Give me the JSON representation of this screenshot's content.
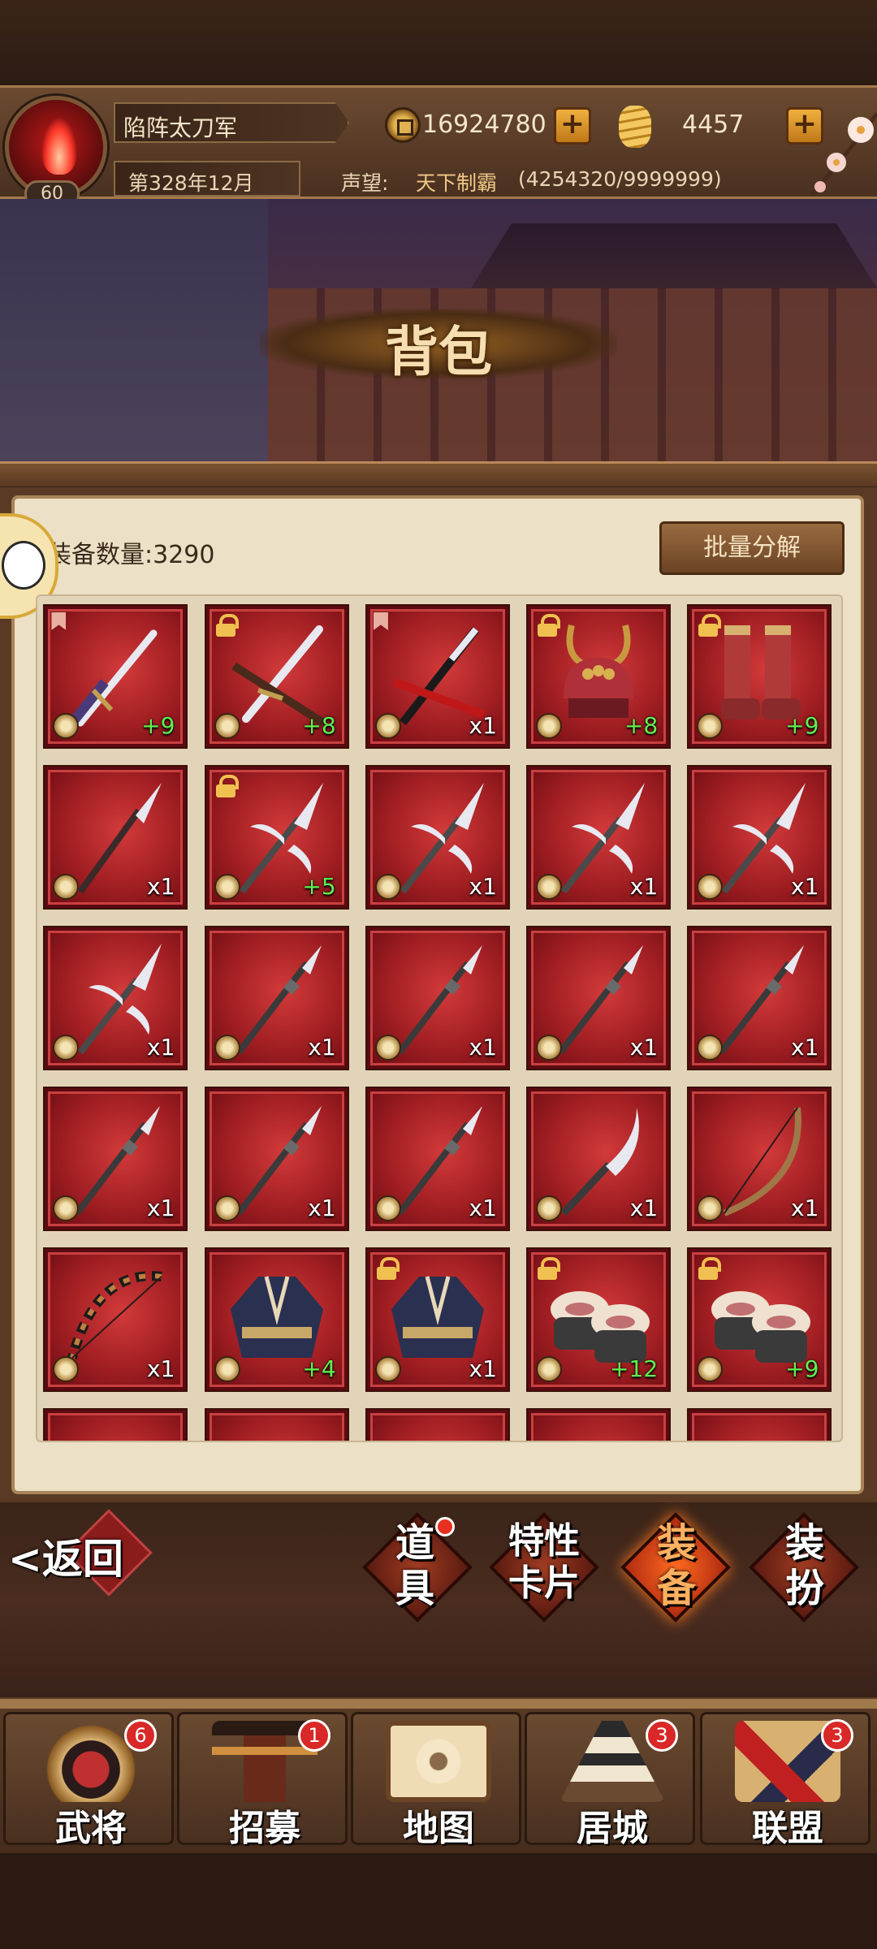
{
  "header": {
    "player_name": "陷阵太刀军",
    "level": "60",
    "game_date": "第328年12月",
    "coins": "16924780",
    "gold": "4457",
    "reputation_label": "声望:",
    "reputation_title": "天下制霸",
    "reputation_progress": "(4254320/9999999)",
    "plus_icon": "+"
  },
  "page": {
    "title": "背包",
    "equip_count_text": "装备数量:3290",
    "batch_button": "批量分解"
  },
  "items": [
    {
      "icon": "katana-icon",
      "qty": "+9",
      "locked": false
    },
    {
      "icon": "katana-pair-icon",
      "qty": "+8",
      "locked": true
    },
    {
      "icon": "katana-red-icon",
      "qty": "x1",
      "locked": false
    },
    {
      "icon": "kabuto-helmet-icon",
      "qty": "+8",
      "locked": true
    },
    {
      "icon": "armored-boots-icon",
      "qty": "+9",
      "locked": true
    },
    {
      "icon": "spear-icon",
      "qty": "x1",
      "locked": false
    },
    {
      "icon": "cross-spear-icon",
      "qty": "+5",
      "locked": true
    },
    {
      "icon": "cross-spear-icon",
      "qty": "x1",
      "locked": false
    },
    {
      "icon": "cross-spear-icon",
      "qty": "x1",
      "locked": false
    },
    {
      "icon": "cross-spear-icon",
      "qty": "x1",
      "locked": false
    },
    {
      "icon": "cross-spear-icon",
      "qty": "x1",
      "locked": false
    },
    {
      "icon": "yari-spear-icon",
      "qty": "x1",
      "locked": false
    },
    {
      "icon": "yari-spear-icon",
      "qty": "x1",
      "locked": false
    },
    {
      "icon": "yari-spear-icon",
      "qty": "x1",
      "locked": false
    },
    {
      "icon": "yari-spear-icon",
      "qty": "x1",
      "locked": false
    },
    {
      "icon": "yari-spear-icon",
      "qty": "x1",
      "locked": false
    },
    {
      "icon": "yari-spear-icon",
      "qty": "x1",
      "locked": false
    },
    {
      "icon": "yari-spear-icon",
      "qty": "x1",
      "locked": false
    },
    {
      "icon": "naginata-icon",
      "qty": "x1",
      "locked": false
    },
    {
      "icon": "longbow-icon",
      "qty": "x1",
      "locked": false
    },
    {
      "icon": "striped-bow-icon",
      "qty": "x1",
      "locked": false
    },
    {
      "icon": "kimono-robe-icon",
      "qty": "+4",
      "locked": false
    },
    {
      "icon": "kimono-robe-icon",
      "qty": "x1",
      "locked": true
    },
    {
      "icon": "sandals-icon",
      "qty": "+12",
      "locked": true
    },
    {
      "icon": "sandals-icon",
      "qty": "+9",
      "locked": true
    }
  ],
  "tabs": [
    {
      "label": "道具",
      "id": "items"
    },
    {
      "label": "特性卡片",
      "id": "trait-cards"
    },
    {
      "label": "装备",
      "id": "equipment"
    },
    {
      "label": "装扮",
      "id": "outfits"
    }
  ],
  "back_label": "<返回",
  "nav": [
    {
      "label": "武将",
      "badge": "6",
      "icon": "samurai-helmet-icon"
    },
    {
      "label": "招募",
      "badge": "1",
      "icon": "recruit-scroll-icon"
    },
    {
      "label": "地图",
      "badge": "",
      "icon": "map-scroll-icon"
    },
    {
      "label": "居城",
      "badge": "3",
      "icon": "castle-icon"
    },
    {
      "label": "联盟",
      "badge": "3",
      "icon": "alliance-banner-icon"
    }
  ],
  "colors": {
    "slot_red": "#a01e22",
    "plus_green": "#5ef050",
    "accent_gold": "#f0b040",
    "active_tab": "#ff7a20"
  }
}
